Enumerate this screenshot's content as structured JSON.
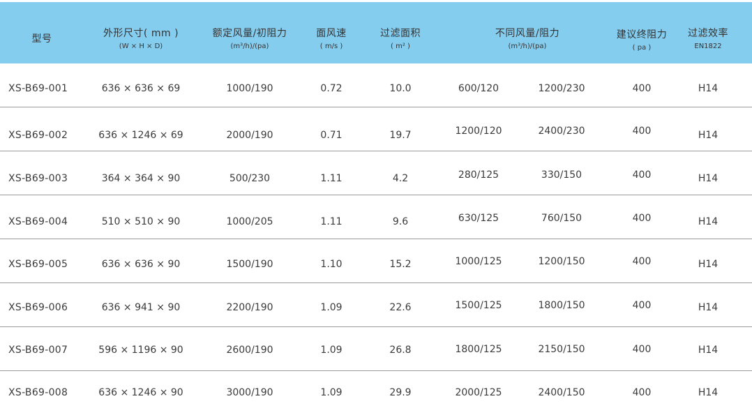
{
  "table": {
    "headers": [
      {
        "title": "型号",
        "sub": ""
      },
      {
        "title": "外形尺寸( mm )",
        "sub": "(W × H × D)"
      },
      {
        "title": "额定风量/初阻力",
        "sub": "(m³/h)/(pa)"
      },
      {
        "title": "面风速",
        "sub": "( m/s )"
      },
      {
        "title": "过滤面积",
        "sub": "( m² )"
      },
      {
        "title": "不同风量/阻力",
        "sub": "(m³/h)/(pa)"
      },
      {
        "title": "建议终阻力",
        "sub": "( pa )"
      },
      {
        "title": "过滤效率",
        "sub": "EN1822"
      }
    ],
    "rows": [
      {
        "model": "XS-B69-001",
        "size": "636 × 636 × 69",
        "rated": "1000/190",
        "velocity": "0.72",
        "area": "10.0",
        "flow1": "600/120",
        "flow2": "1200/230",
        "final": "400",
        "eff": "H14"
      },
      {
        "model": "XS-B69-002",
        "size": "636 × 1246 × 69",
        "rated": "2000/190",
        "velocity": "0.71",
        "area": "19.7",
        "flow1": "1200/120",
        "flow2": "2400/230",
        "final": "400",
        "eff": "H14"
      },
      {
        "model": "XS-B69-003",
        "size": "364 × 364 × 90",
        "rated": "500/230",
        "velocity": "1.11",
        "area": "4.2",
        "flow1": "280/125",
        "flow2": "330/150",
        "final": "400",
        "eff": "H14"
      },
      {
        "model": "XS-B69-004",
        "size": "510 × 510 × 90",
        "rated": "1000/205",
        "velocity": "1.11",
        "area": "9.6",
        "flow1": "630/125",
        "flow2": "760/150",
        "final": "400",
        "eff": "H14"
      },
      {
        "model": "XS-B69-005",
        "size": "636 × 636 × 90",
        "rated": "1500/190",
        "velocity": "1.10",
        "area": "15.2",
        "flow1": "1000/125",
        "flow2": "1200/150",
        "final": "400",
        "eff": "H14"
      },
      {
        "model": "XS-B69-006",
        "size": "636 × 941 × 90",
        "rated": "2200/190",
        "velocity": "1.09",
        "area": "22.6",
        "flow1": "1500/125",
        "flow2": "1800/150",
        "final": "400",
        "eff": "H14"
      },
      {
        "model": "XS-B69-007",
        "size": "596 × 1196 × 90",
        "rated": "2600/190",
        "velocity": "1.09",
        "area": "26.8",
        "flow1": "1800/125",
        "flow2": "2150/150",
        "final": "400",
        "eff": "H14"
      },
      {
        "model": "XS-B69-008",
        "size": "636 × 1246 × 90",
        "rated": "3000/190",
        "velocity": "1.09",
        "area": "29.9",
        "flow1": "2000/125",
        "flow2": "2400/150",
        "final": "400",
        "eff": "H14"
      }
    ]
  },
  "colors": {
    "header_bg": "#85CDEF",
    "text": "#333333",
    "divider": "#9a9a9a"
  }
}
